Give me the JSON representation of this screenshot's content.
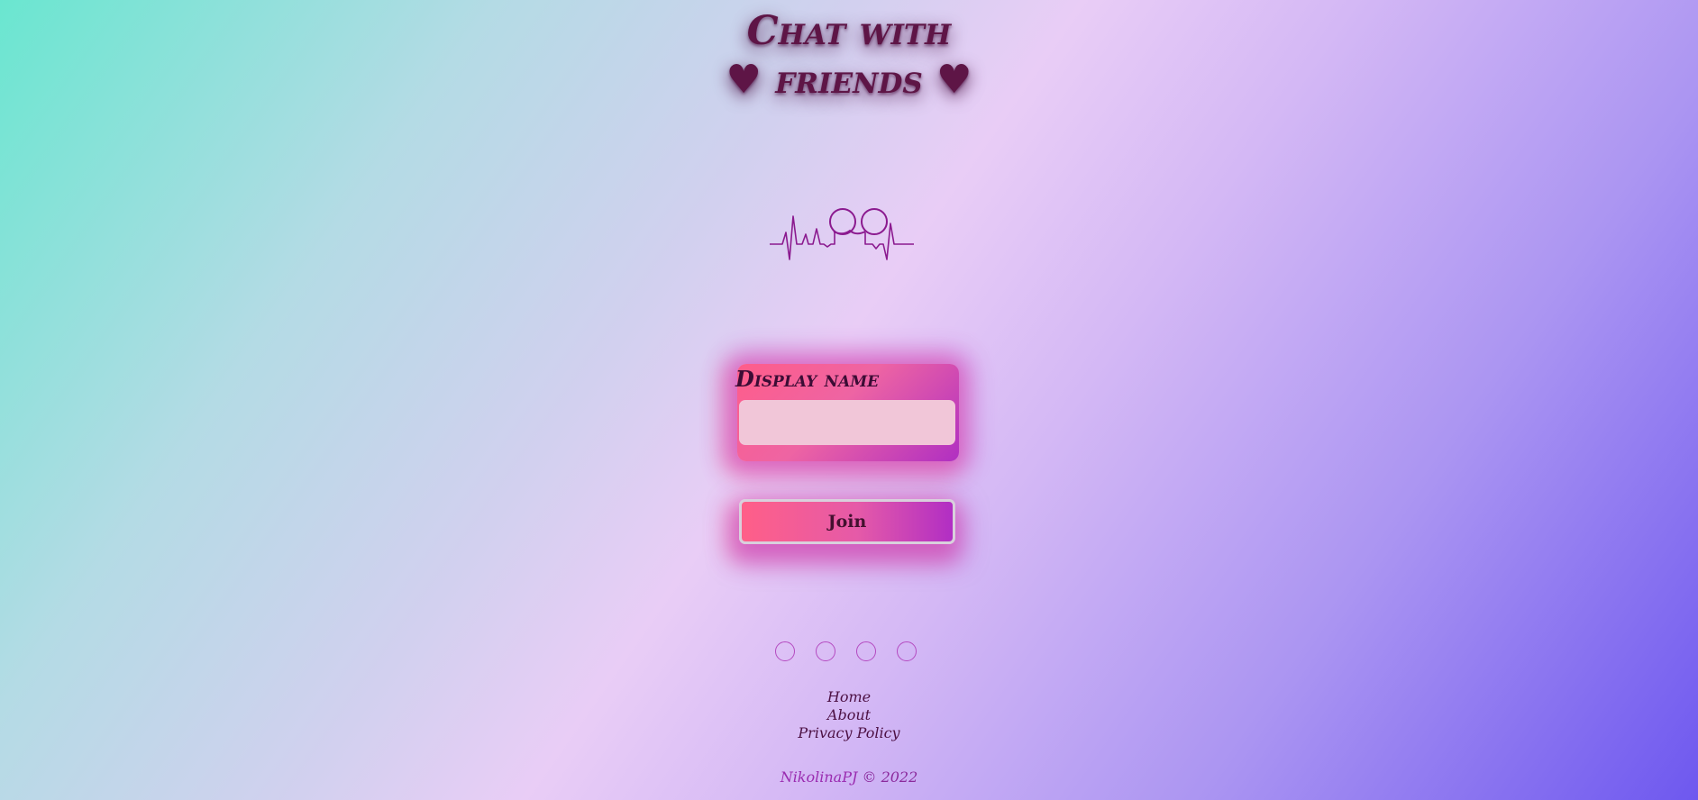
{
  "header": {
    "title_line1": "Chat with",
    "title_line2": "♥ friends ♥"
  },
  "form": {
    "name_label": "Display name",
    "name_value": "",
    "join_label": "Join"
  },
  "social_icons": [
    "social-icon-1",
    "social-icon-2",
    "social-icon-3",
    "social-icon-4"
  ],
  "footer": {
    "links": [
      "Home",
      "About",
      "Privacy Policy"
    ],
    "author": "NikolinaPJ",
    "copyright": "© 2022"
  },
  "colors": {
    "title": "#5e1546",
    "heartbeat": "#8b1a8f",
    "input_bg": "#f1c6d8",
    "button_gradient_start": "#ff5f88",
    "button_gradient_end": "#b12ec4"
  }
}
